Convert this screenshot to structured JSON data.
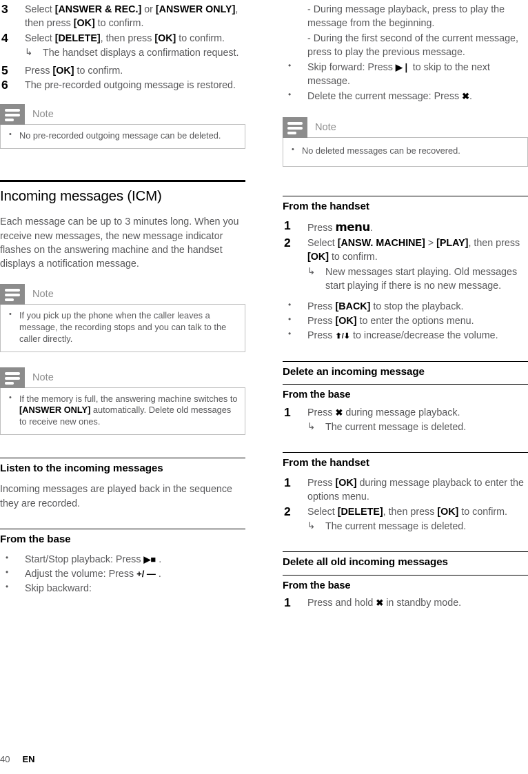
{
  "footer": {
    "page_number": "40",
    "language": "EN"
  },
  "left_column": {
    "steps_top": [
      {
        "num": "3",
        "text_parts": [
          "Select ",
          "[ANSWER & REC.]",
          " or ",
          "[ANSWER ONLY]",
          ", then press ",
          "[OK]",
          " to confirm."
        ]
      },
      {
        "num": "4",
        "text_parts": [
          "Select ",
          "[DELETE]",
          ", then press ",
          "[OK]",
          " to confirm."
        ],
        "arrow": "The handset displays a confirmation request."
      },
      {
        "num": "5",
        "text_parts": [
          "Press ",
          "[OK]",
          " to confirm."
        ]
      },
      {
        "num": "6",
        "text_parts": [
          "The pre-recorded outgoing message is restored."
        ]
      }
    ],
    "note_1": {
      "title": "Note",
      "items": [
        "No pre-recorded outgoing message can be deleted."
      ]
    },
    "heading_icm": "Incoming messages (ICM)",
    "paragraph_icm": "Each message can be up to 3 minutes long. When you receive new messages, the new message indicator flashes on the answering machine and the handset displays a notification message.",
    "note_2": {
      "title": "Note",
      "items": [
        "If you pick up the phone when the caller leaves a message, the recording stops and you can talk to the caller directly."
      ]
    },
    "note_3": {
      "title": "Note",
      "items_parts": [
        [
          "If the memory is full, the answering machine switches to ",
          "[ANSWER ONLY]",
          " automatically. Delete old messages to receive new ones."
        ]
      ]
    },
    "heading_listen": "Listen to the incoming messages",
    "paragraph_listen": "Incoming messages are played back in the sequence they are recorded.",
    "heading_from_base": "From the base",
    "base_bullets": [
      {
        "pre": "Start/Stop playback: Press ",
        "symbol": "▶■",
        "post": " ."
      },
      {
        "pre": "Adjust the volume: Press ",
        "symbol": "+/ —",
        "post": " ."
      },
      {
        "pre": "Skip backward:",
        "symbol": "",
        "post": ""
      }
    ]
  },
  "right_column": {
    "continued_dashes": [
      "- During message playback, press  to play the message from the beginning.",
      "- During the first second of the current message, press  to play the previous message."
    ],
    "top_bullets": [
      {
        "pre": "Skip forward: Press ",
        "symbol": "▶❘",
        "post": " to skip to the next message."
      },
      {
        "pre": "Delete the current message: Press ",
        "symbol": "✖",
        "post": "."
      }
    ],
    "note_1": {
      "title": "Note",
      "items": [
        "No deleted messages can be recovered."
      ]
    },
    "heading_from_handset_1": "From the handset",
    "handset_steps": [
      {
        "num": "1",
        "text_parts": [
          "Press ",
          "menu",
          "."
        ],
        "menu_bold": true
      },
      {
        "num": "2",
        "text_parts": [
          "Select ",
          "[ANSW. MACHINE]",
          " > ",
          "[PLAY]",
          ", then press ",
          "[OK]",
          " to confirm."
        ],
        "arrow": "New messages start playing. Old messages start playing if there is no new message."
      }
    ],
    "handset_bullets": [
      {
        "pre": "Press ",
        "key": "[BACK]",
        "post": " to stop the playback."
      },
      {
        "pre": "Press ",
        "key": "[OK]",
        "post": " to enter the options menu."
      },
      {
        "pre": "Press ",
        "symbol": "⬆/⬇",
        "post": " to increase/decrease the volume."
      }
    ],
    "heading_delete_one": "Delete an incoming message",
    "heading_from_base_1": "From the base",
    "delete_base_steps": [
      {
        "num": "1",
        "pre": "Press ",
        "symbol": "✖",
        "post": " during message playback.",
        "arrow": "The current message is deleted."
      }
    ],
    "heading_from_handset_2": "From the handset",
    "delete_handset_steps": [
      {
        "num": "1",
        "text_parts": [
          "Press ",
          "[OK]",
          " during message playback to enter the options menu."
        ]
      },
      {
        "num": "2",
        "text_parts": [
          "Select ",
          "[DELETE]",
          ", then press ",
          "[OK]",
          " to confirm."
        ],
        "arrow": "The current message is deleted."
      }
    ],
    "heading_delete_all": "Delete all old incoming messages",
    "heading_from_base_2": "From the base",
    "delete_all_steps": [
      {
        "num": "1",
        "pre": "Press and hold ",
        "symbol": "✖",
        "post": " in standby mode."
      }
    ]
  }
}
